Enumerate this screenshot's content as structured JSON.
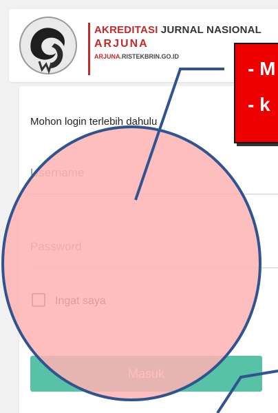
{
  "header": {
    "logo_icon": "arjuna-logo-icon",
    "brand_line1_accent": "AKREDITASI",
    "brand_line1_rest": " JURNAL NASIONAL",
    "brand_line2": "ARJUNA",
    "brand_line3_accent": "ARJUNA.",
    "brand_line3_rest": "RISTEKBRIN.GO.ID"
  },
  "login": {
    "prompt": "Mohon login terlebih dahulu",
    "username_placeholder": "Username",
    "password_placeholder": "Password",
    "remember_label": "Ingat saya",
    "submit_label": "Masuk"
  },
  "annotation": {
    "line1": "- M",
    "line2": "- k"
  },
  "colors": {
    "brand_red": "#c62828",
    "button_green": "#58c2a6",
    "highlight_fill": "#ffb3b3",
    "highlight_stroke": "#2f5490",
    "note_red": "#ee0000"
  }
}
